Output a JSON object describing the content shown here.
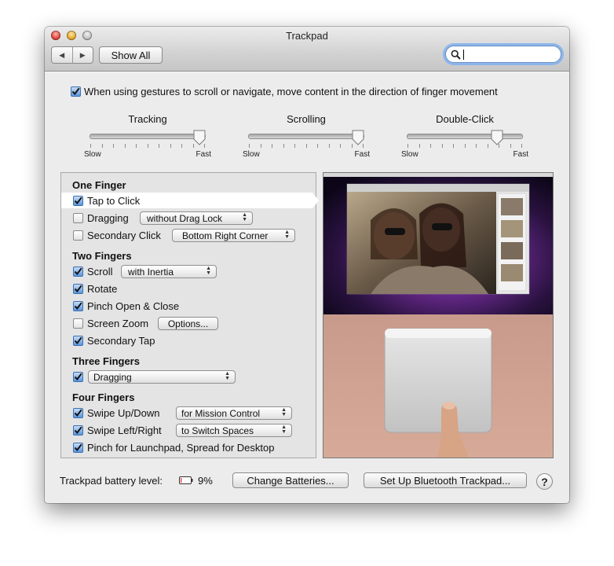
{
  "window": {
    "title": "Trackpad"
  },
  "toolbar": {
    "back_icon": "back-arrow-icon",
    "forward_icon": "forward-arrow-icon",
    "show_all": "Show All",
    "search_value": ""
  },
  "natural_scroll": {
    "checked": true,
    "label": "When using gestures to scroll or navigate, move content in the direction of finger movement"
  },
  "sliders": [
    {
      "label": "Tracking",
      "min_label": "Slow",
      "max_label": "Fast",
      "value": 0.95
    },
    {
      "label": "Scrolling",
      "min_label": "Slow",
      "max_label": "Fast",
      "value": 0.95
    },
    {
      "label": "Double-Click",
      "min_label": "Slow",
      "max_label": "Fast",
      "value": 0.78
    }
  ],
  "sections": {
    "one_finger": "One Finger",
    "two_fingers": "Two Fingers",
    "three_fingers": "Three Fingers",
    "four_fingers": "Four Fingers"
  },
  "gestures": {
    "tap_to_click": {
      "label": "Tap to Click",
      "checked": true
    },
    "dragging": {
      "label": "Dragging",
      "checked": false,
      "popup": "without Drag Lock"
    },
    "secondary_click": {
      "label": "Secondary Click",
      "checked": false,
      "popup": "Bottom Right Corner"
    },
    "scroll": {
      "label": "Scroll",
      "checked": true,
      "popup": "with Inertia"
    },
    "rotate": {
      "label": "Rotate",
      "checked": true
    },
    "pinch": {
      "label": "Pinch Open & Close",
      "checked": true
    },
    "screen_zoom": {
      "label": "Screen Zoom",
      "checked": false,
      "button": "Options..."
    },
    "secondary_tap": {
      "label": "Secondary Tap",
      "checked": true
    },
    "three_finger": {
      "checked": true,
      "popup": "Dragging"
    },
    "swipe_up_down": {
      "label": "Swipe Up/Down",
      "checked": true,
      "popup": "for Mission Control"
    },
    "swipe_left_right": {
      "label": "Swipe Left/Right",
      "checked": true,
      "popup": "to Switch Spaces"
    },
    "launchpad": {
      "label": "Pinch for Launchpad, Spread for Desktop",
      "checked": true
    }
  },
  "footer": {
    "battery_label": "Trackpad battery level:",
    "battery_percent": "9%",
    "battery_level": 0.09,
    "change_batteries": "Change Batteries...",
    "setup_bluetooth": "Set Up Bluetooth Trackpad...",
    "help": "?"
  },
  "colors": {
    "accent": "#5a95dc",
    "battery_low": "#e02020",
    "focus_ring": "#8db6ea"
  }
}
